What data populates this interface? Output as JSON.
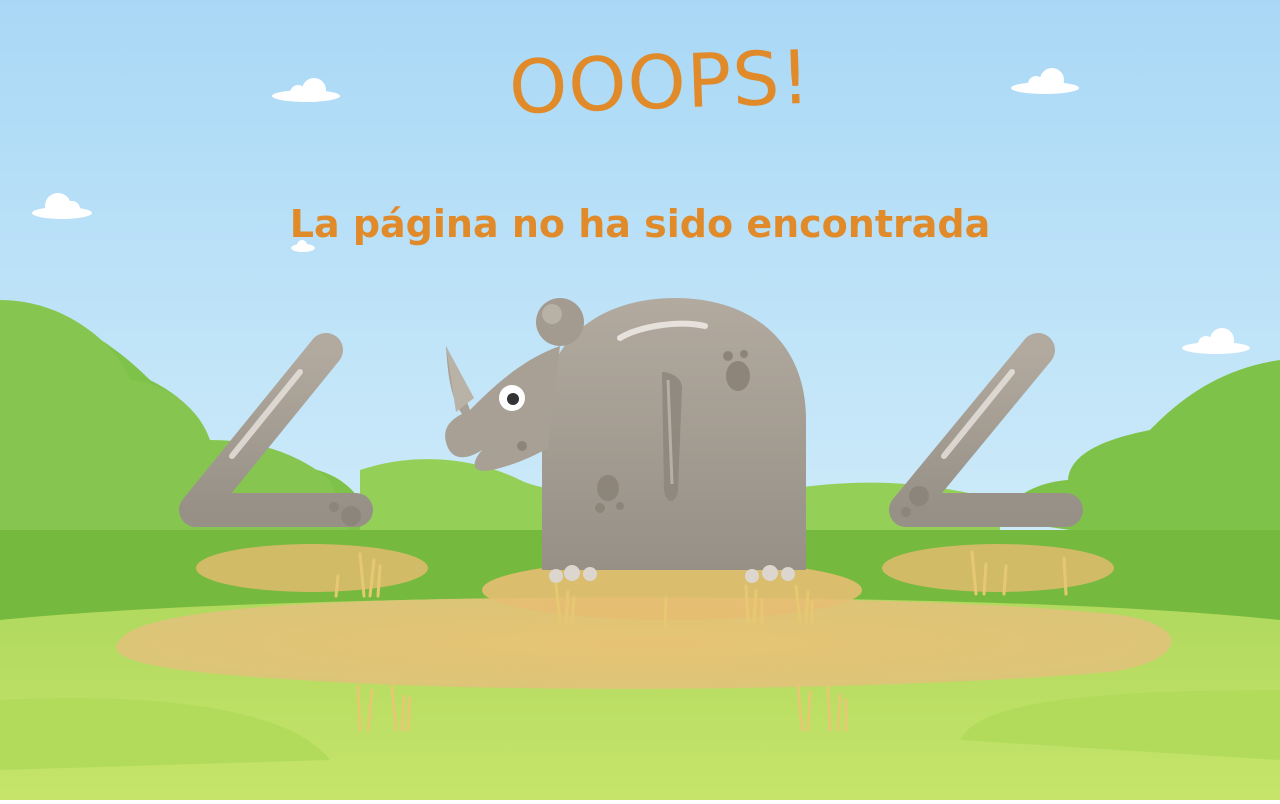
{
  "page": {
    "title": "OOOPS!",
    "subtitle": "La página no ha sido encontrada"
  },
  "colors": {
    "accent": "#e08a2a",
    "sky_top": "#b7def7",
    "sky_bottom": "#d8f0fb",
    "hill_dark": "#6cbc3a",
    "hill_light": "#9fd65b",
    "path": "#e6c27a",
    "rhino": "#a79f93"
  },
  "illustration": {
    "left_digit": "4",
    "right_digit": "4",
    "middle_digit_depicted_by": "rhino-body",
    "clouds": 5,
    "grass_tufts": 8
  }
}
